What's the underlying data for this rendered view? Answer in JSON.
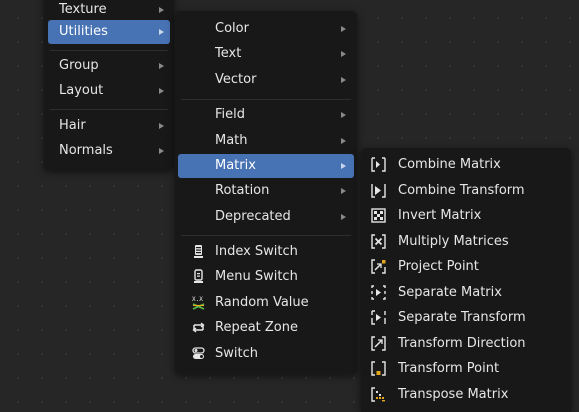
{
  "menu1": {
    "items": [
      {
        "label": "Texture",
        "submenu": true
      },
      {
        "label": "Utilities",
        "submenu": true,
        "active": true
      },
      {
        "label": "Group",
        "submenu": true
      },
      {
        "label": "Layout",
        "submenu": true
      },
      {
        "label": "Hair",
        "submenu": true
      },
      {
        "label": "Normals",
        "submenu": true
      }
    ]
  },
  "menu2": {
    "items": [
      {
        "label": "Color",
        "submenu": true
      },
      {
        "label": "Text",
        "submenu": true
      },
      {
        "label": "Vector",
        "submenu": true
      },
      {
        "label": "Field",
        "submenu": true
      },
      {
        "label": "Math",
        "submenu": true
      },
      {
        "label": "Matrix",
        "submenu": true,
        "active": true
      },
      {
        "label": "Rotation",
        "submenu": true
      },
      {
        "label": "Deprecated",
        "submenu": true
      },
      {
        "label": "Index Switch",
        "icon": "index-switch-icon"
      },
      {
        "label": "Menu Switch",
        "icon": "menu-switch-icon"
      },
      {
        "label": "Random Value",
        "icon": "random-value-icon"
      },
      {
        "label": "Repeat Zone",
        "icon": "repeat-zone-icon"
      },
      {
        "label": "Switch",
        "icon": "switch-icon"
      }
    ]
  },
  "menu3": {
    "items": [
      {
        "label": "Combine Matrix",
        "icon": "combine-matrix-icon"
      },
      {
        "label": "Combine Transform",
        "icon": "combine-transform-icon"
      },
      {
        "label": "Invert Matrix",
        "icon": "invert-matrix-icon"
      },
      {
        "label": "Multiply Matrices",
        "icon": "multiply-matrices-icon"
      },
      {
        "label": "Project Point",
        "icon": "project-point-icon"
      },
      {
        "label": "Separate Matrix",
        "icon": "separate-matrix-icon"
      },
      {
        "label": "Separate Transform",
        "icon": "separate-transform-icon"
      },
      {
        "label": "Transform Direction",
        "icon": "transform-direction-icon"
      },
      {
        "label": "Transform Point",
        "icon": "transform-point-icon"
      },
      {
        "label": "Transpose Matrix",
        "icon": "transpose-matrix-icon"
      }
    ]
  },
  "colors": {
    "background": "#262626",
    "menu": "#181818",
    "highlight": "#4772b3",
    "text": "#e6e6e6",
    "icon_accent": "#e3a81e",
    "icon_green": "#59b84a"
  }
}
